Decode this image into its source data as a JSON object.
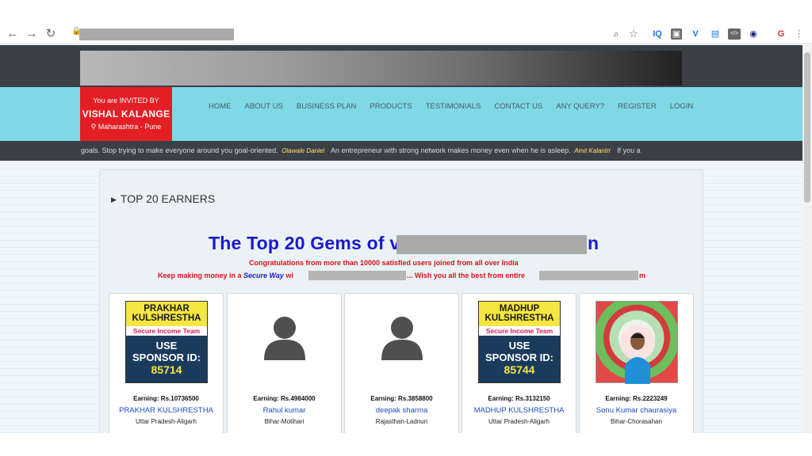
{
  "browser": {
    "back": "←",
    "forward": "→",
    "reload": "↻",
    "lock": "🔒",
    "zoom_icon": "⌕",
    "star_icon": "☆",
    "extensions": [
      "IQ",
      "▣",
      "V",
      "▤",
      "</>",
      "◉",
      "G",
      "⋮"
    ]
  },
  "header": {
    "invite_line1": "You are INVITED BY",
    "invite_name": "VISHAL KALANGE",
    "invite_location": "⚲ Maharashtra - Pune",
    "menu": [
      "HOME",
      "ABOUT US",
      "BUSINESS PLAN",
      "PRODUCTS",
      "TESTIMONIALS",
      "CONTACT US",
      "ANY QUERY?",
      "REGISTER",
      "LOGIN"
    ]
  },
  "ticker": {
    "q1": "goals. Stop trying to make everyone around you goal-oriented.",
    "a1": "Olawale Daniel",
    "q2": "An entrepreneur with strong network makes money even when he is asleep.",
    "a2": "Amit Kalantri",
    "q3": "If you a"
  },
  "section": {
    "title": "TOP 20 EARNERS",
    "gems_prefix": "The Top 20 Gems of ",
    "gems_letter": "v",
    "gems_tail": "n",
    "congrats": "Congratulations from more than 10000 satisfied users joined from all over India",
    "keep_prefix": "Keep making money in a ",
    "secure_way": "Secure Way",
    "keep_mid": " wi",
    "keep_wish": "... Wish you all the best from entire",
    "keep_tail": "m"
  },
  "earners": [
    {
      "photo_name": "PRAKHAR KULSHRESTHA",
      "team": "Secure Income Team",
      "use": "USE",
      "sponsor": "SPONSOR ID:",
      "id": "85714",
      "earning": "Earning: Rs.10736500",
      "name": "PRAKHAR KULSHRESTHA",
      "place": "Uttar Pradesh-Aligarh"
    },
    {
      "earning": "Earning: Rs.4984000",
      "name": "Rahul kumar",
      "place": "Bihar-Motihari"
    },
    {
      "earning": "Earning: Rs.3858800",
      "name": "deepak sharma",
      "place": "Rajasthan-Ladnun"
    },
    {
      "photo_name": "MADHUP KULSHRESTHA",
      "team": "Secure Income Team",
      "use": "USE",
      "sponsor": "SPONSOR ID:",
      "id": "85744",
      "earning": "Earning: Rs.3132150",
      "name": "MADHUP KULSHRESTHA",
      "place": "Uttar Pradesh-Aligarh"
    },
    {
      "earning": "Earning: Rs.2223249",
      "name": "Sonu Kumar chaurasiya",
      "place": "Bihar-Chorasahan"
    }
  ]
}
